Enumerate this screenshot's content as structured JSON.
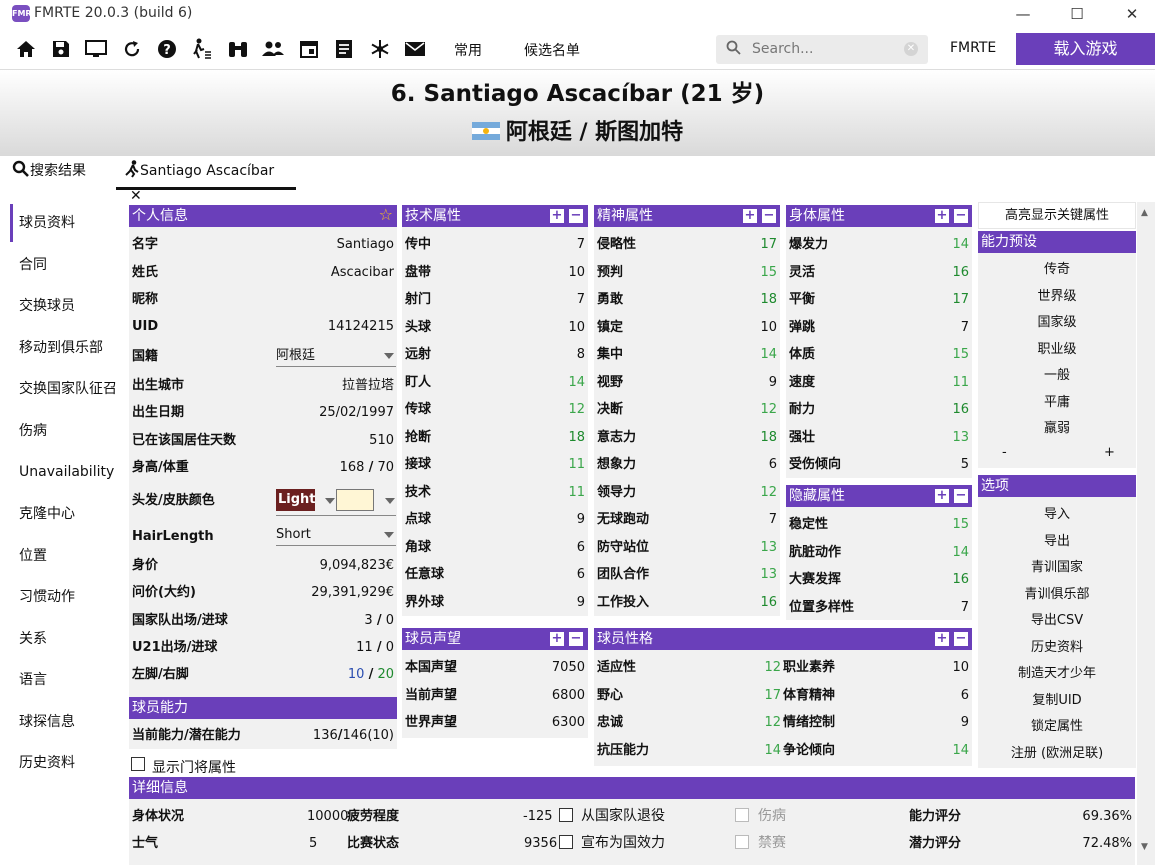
{
  "window": {
    "title": "FMRTE 20.0.3 (build 6)",
    "app_icon_text": "FMRTE"
  },
  "toolbar": {
    "icons": [
      "home-icon",
      "save-icon",
      "monitor-icon",
      "refresh-icon",
      "help-icon",
      "person-walking-icon",
      "binoculars-icon",
      "people-icon",
      "calendar-icon",
      "document-icon",
      "settings-snowflake-icon",
      "mail-icon"
    ],
    "common_label": "常用",
    "shortlist_label": "候选名单",
    "search_placeholder": "Search...",
    "fmrte_label": "FMRTE",
    "load_game_label": "载入游戏"
  },
  "header": {
    "player_title": "6. Santiago Ascacíbar (21 岁)",
    "club_line": "阿根廷 / 斯图加特"
  },
  "tabs": [
    {
      "label": "搜索结果"
    },
    {
      "label": "Santiago Ascacíbar"
    }
  ],
  "nav": [
    "球员资料",
    "合同",
    "交换球员",
    "移动到俱乐部",
    "交换国家队征召",
    "伤病",
    "Unavailability",
    "克隆中心",
    "位置",
    "习惯动作",
    "关系",
    "语言",
    "球探信息",
    "历史资料"
  ],
  "personal": {
    "title": "个人信息",
    "first_name_label": "名字",
    "first_name": "Santiago",
    "last_name_label": "姓氏",
    "last_name": "Ascacibar",
    "nickname_label": "昵称",
    "uid_label": "UID",
    "uid": "14124215",
    "nationality_label": "国籍",
    "nationality": "阿根廷",
    "birth_city_label": "出生城市",
    "birth_city": "拉普拉塔",
    "dob_label": "出生日期",
    "dob": "25/02/1997",
    "days_label": "已在该国居住天数",
    "days": "510",
    "hw_label": "身高/体重",
    "height": "168",
    "sep": "/",
    "weight": "70",
    "hair_label": "头发/皮肤颜色",
    "hair_value": "Light",
    "hairlength_label": "HairLength",
    "hairlength": "Short",
    "value_label": "身价",
    "value": "9,094,823€",
    "asking_label": "问价(大约)",
    "asking": "29,391,929€",
    "intl_label": "国家队出场/进球",
    "intl_caps": "3",
    "intl_goals": "0",
    "u21_label": "U21出场/进球",
    "u21_caps": "11",
    "u21_goals": "0",
    "foot_label": "左脚/右脚",
    "left_foot": "10",
    "right_foot": "20"
  },
  "ability": {
    "title": "球员能力",
    "label": "当前能力/潜在能力",
    "ca": "136",
    "pa": "146(10)"
  },
  "gk_check_label": "显示门将属性",
  "technical": {
    "title": "技术属性",
    "rows": [
      [
        "传中",
        "7",
        "n"
      ],
      [
        "盘带",
        "10",
        "n"
      ],
      [
        "射门",
        "7",
        "n"
      ],
      [
        "头球",
        "10",
        "n"
      ],
      [
        "远射",
        "8",
        "n"
      ],
      [
        "盯人",
        "14",
        "g"
      ],
      [
        "传球",
        "12",
        "g"
      ],
      [
        "抢断",
        "18",
        "dg"
      ],
      [
        "接球",
        "11",
        "g"
      ],
      [
        "技术",
        "11",
        "g"
      ],
      [
        "点球",
        "9",
        "n"
      ],
      [
        "角球",
        "6",
        "n"
      ],
      [
        "任意球",
        "6",
        "n"
      ],
      [
        "界外球",
        "9",
        "n"
      ]
    ]
  },
  "mental": {
    "title": "精神属性",
    "rows": [
      [
        "侵略性",
        "17",
        "dg"
      ],
      [
        "预判",
        "15",
        "g"
      ],
      [
        "勇敢",
        "18",
        "dg"
      ],
      [
        "镇定",
        "10",
        "n"
      ],
      [
        "集中",
        "14",
        "g"
      ],
      [
        "视野",
        "9",
        "n"
      ],
      [
        "决断",
        "12",
        "g"
      ],
      [
        "意志力",
        "18",
        "dg"
      ],
      [
        "想象力",
        "6",
        "n"
      ],
      [
        "领导力",
        "12",
        "g"
      ],
      [
        "无球跑动",
        "7",
        "n"
      ],
      [
        "防守站位",
        "13",
        "g"
      ],
      [
        "团队合作",
        "13",
        "g"
      ],
      [
        "工作投入",
        "16",
        "dg"
      ]
    ]
  },
  "physical": {
    "title": "身体属性",
    "rows": [
      [
        "爆发力",
        "14",
        "g"
      ],
      [
        "灵活",
        "16",
        "dg"
      ],
      [
        "平衡",
        "17",
        "dg"
      ],
      [
        "弹跳",
        "7",
        "n"
      ],
      [
        "体质",
        "15",
        "g"
      ],
      [
        "速度",
        "11",
        "g"
      ],
      [
        "耐力",
        "16",
        "dg"
      ],
      [
        "强壮",
        "13",
        "g"
      ],
      [
        "受伤倾向",
        "5",
        "n"
      ]
    ]
  },
  "hidden": {
    "title": "隐藏属性",
    "rows": [
      [
        "稳定性",
        "15",
        "g"
      ],
      [
        "肮脏动作",
        "14",
        "g"
      ],
      [
        "大赛发挥",
        "16",
        "dg"
      ],
      [
        "位置多样性",
        "7",
        "n"
      ]
    ]
  },
  "reputation": {
    "title": "球员声望",
    "rows": [
      [
        "本国声望",
        "7050"
      ],
      [
        "当前声望",
        "6800"
      ],
      [
        "世界声望",
        "6300"
      ]
    ]
  },
  "personality": {
    "title": "球员性格",
    "rows": [
      [
        "适应性",
        "12",
        "职业素养",
        "10"
      ],
      [
        "野心",
        "17",
        "体育精神",
        "6"
      ],
      [
        "忠诚",
        "12",
        "情绪控制",
        "9"
      ],
      [
        "抗压能力",
        "14",
        "争论倾向",
        "14"
      ]
    ]
  },
  "highlight_label": "高亮显示关键属性",
  "presets": {
    "title": "能力预设",
    "items": [
      "传奇",
      "世界级",
      "国家级",
      "职业级",
      "一般",
      "平庸",
      "羸弱"
    ],
    "minus": "-",
    "plus": "+"
  },
  "options": {
    "title": "选项",
    "items": [
      "导入",
      "导出",
      "青训国家",
      "青训俱乐部",
      "导出CSV",
      "历史资料",
      "制造天才少年",
      "复制UID",
      "锁定属性",
      "注册 (欧洲足联)"
    ]
  },
  "details": {
    "title": "详细信息",
    "condition_label": "身体状况",
    "condition": "10000",
    "fatigue_label": "疲劳程度",
    "fatigue": "-125",
    "morale_label": "士气",
    "morale": "5",
    "match_fitness_label": "比赛状态",
    "match_fitness": "9356",
    "retire_intl_label": "从国家队退役",
    "declared_label": "宣布为国效力",
    "injured_label": "伤病",
    "banned_label": "禁赛",
    "ability_rating_label": "能力评分",
    "ability_rating": "69.36%",
    "potential_rating_label": "潜力评分",
    "potential_rating": "72.48%"
  },
  "colors": {
    "accent": "#6a3fba",
    "green": "#3aa64a",
    "dark_green": "#1e8a2e",
    "hair": "#6b2020",
    "skin": "#fff6d5"
  }
}
